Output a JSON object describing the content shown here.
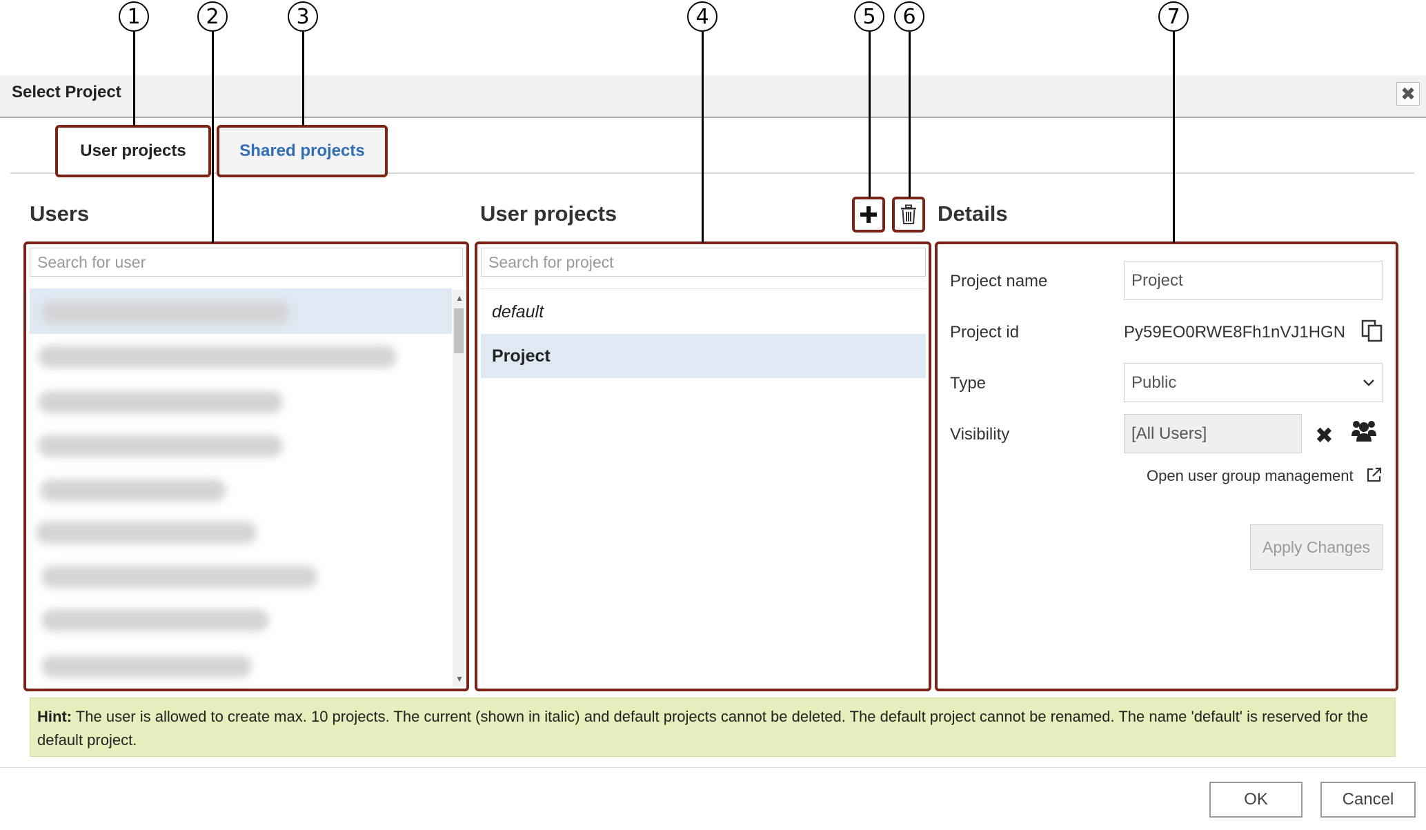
{
  "callouts": [
    "1",
    "2",
    "3",
    "4",
    "5",
    "6",
    "7"
  ],
  "dialog": {
    "title": "Select Project",
    "close_icon": "close-icon"
  },
  "tabs": {
    "user": "User projects",
    "shared": "Shared projects"
  },
  "users": {
    "title": "Users",
    "search_placeholder": "Search for user"
  },
  "projects": {
    "title": "User projects",
    "search_placeholder": "Search for project",
    "items": [
      "default",
      "Project"
    ]
  },
  "details": {
    "title": "Details",
    "project_name_label": "Project name",
    "project_name_value": "Project",
    "project_id_label": "Project id",
    "project_id_value": "Py59EO0RWE8Fh1nVJ1HGN",
    "type_label": "Type",
    "type_value": "Public",
    "visibility_label": "Visibility",
    "visibility_value": "[All Users]",
    "group_link": "Open user group management",
    "apply": "Apply Changes"
  },
  "hint": {
    "label": "Hint:",
    "text": " The user is allowed to create max. 10 projects. The current (shown in italic) and default projects cannot be deleted. The default project cannot be renamed. The name 'default' is reserved for the default project."
  },
  "footer": {
    "ok": "OK",
    "cancel": "Cancel"
  }
}
